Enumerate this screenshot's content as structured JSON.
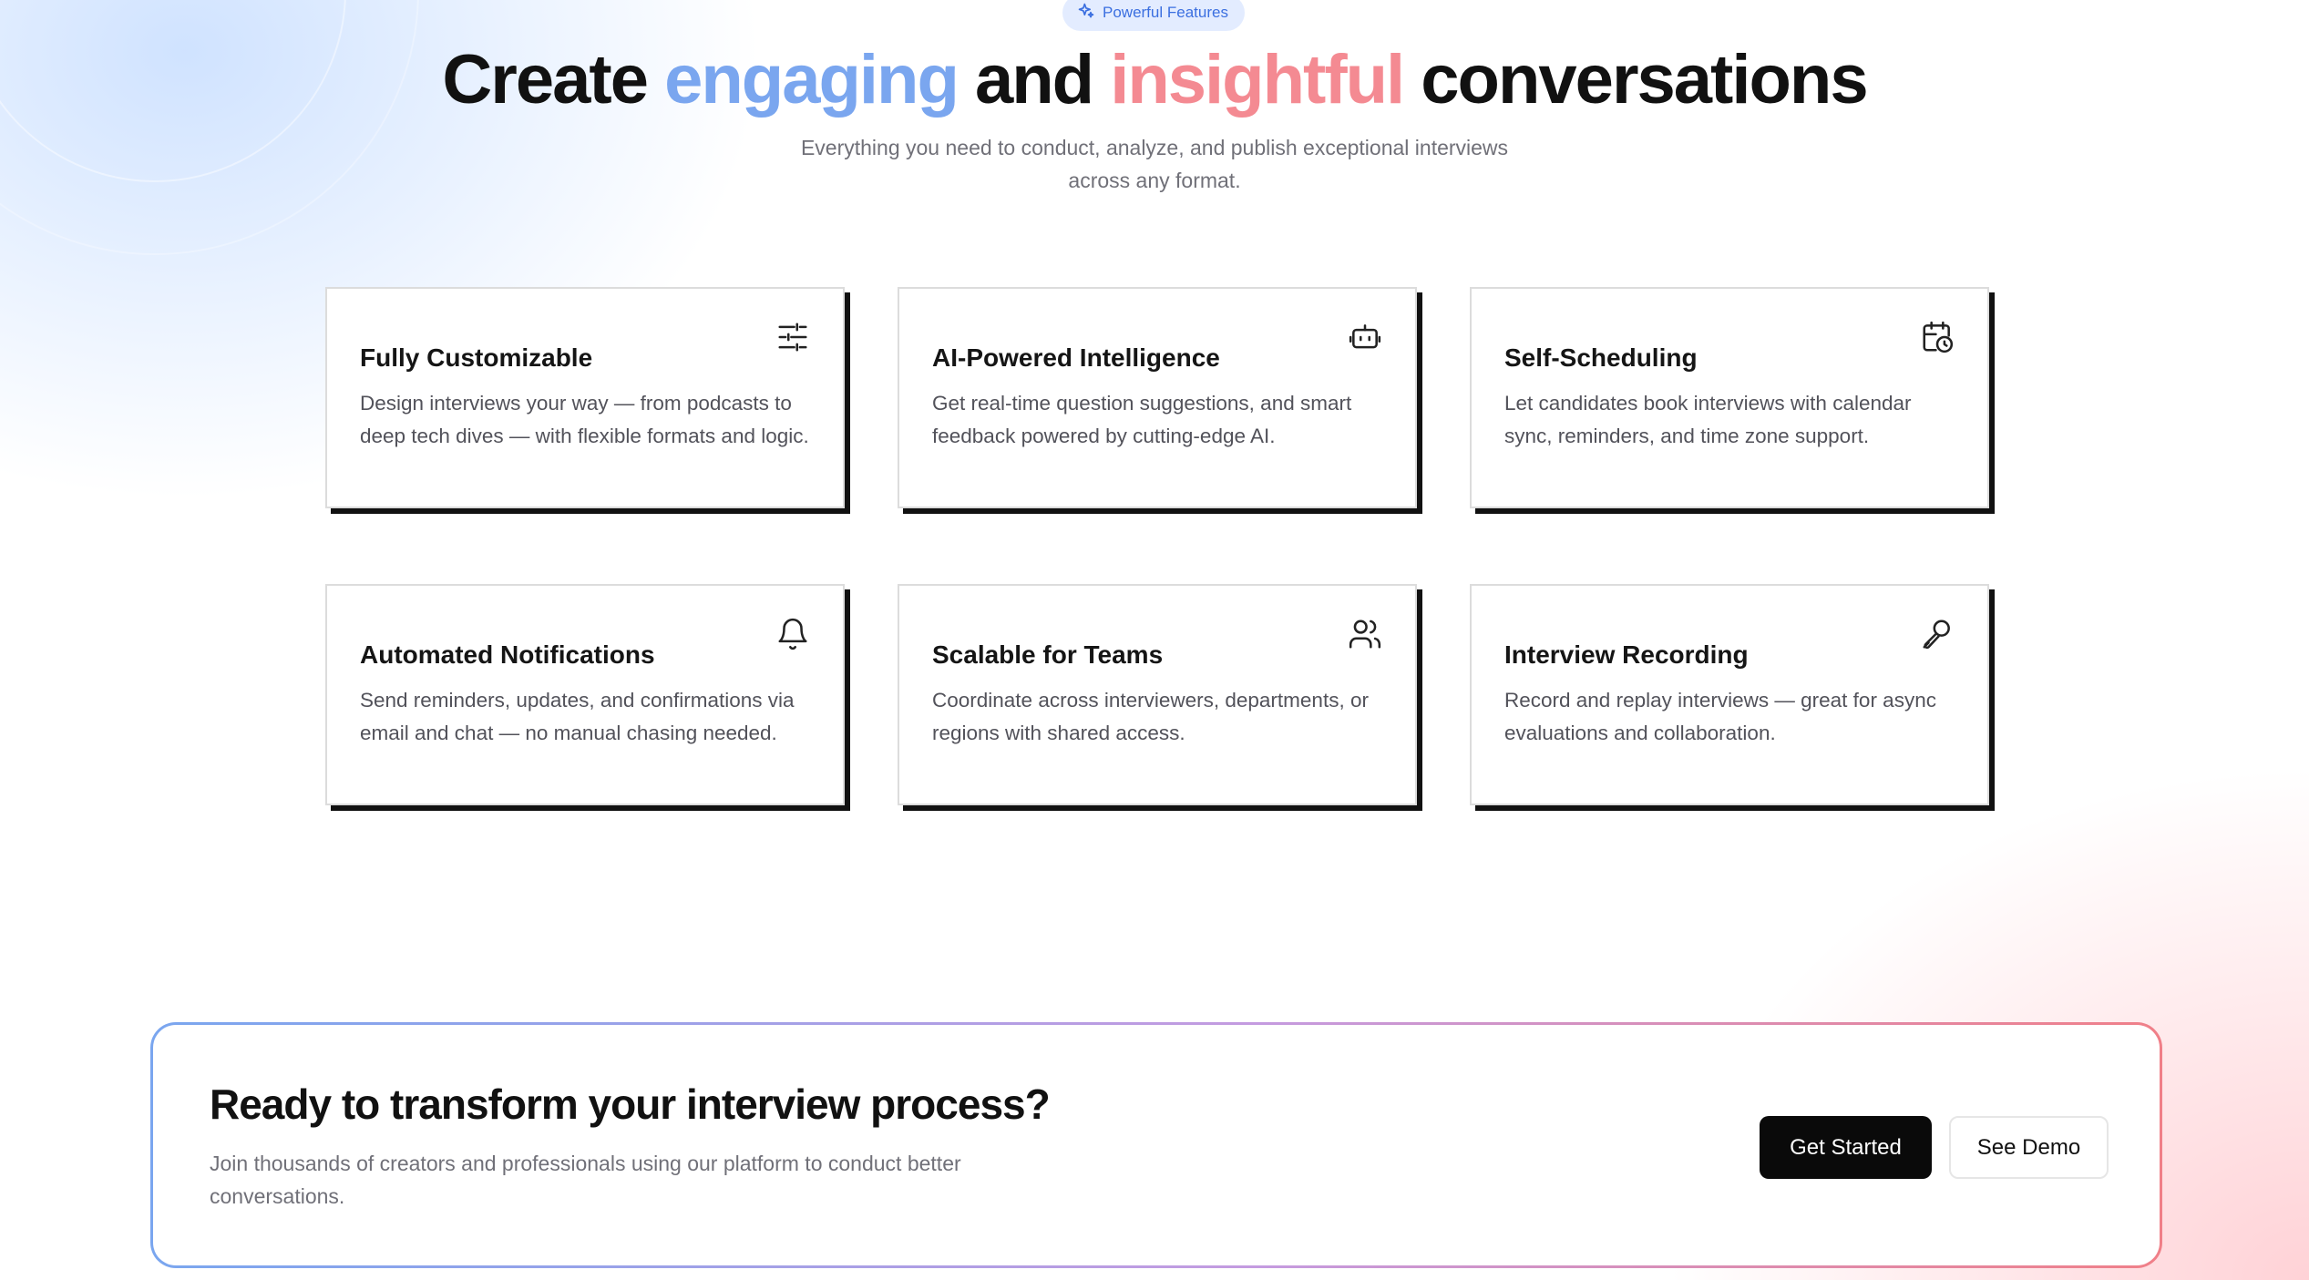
{
  "badge": {
    "icon": "sparkle-icon",
    "label": "Powerful Features"
  },
  "hero": {
    "title_part1": "Create ",
    "title_highlight1": "engaging",
    "title_part2": " and ",
    "title_highlight2": "insightful",
    "title_part3": " conversations",
    "subtitle_line1": "Everything you need to conduct, analyze, and publish exceptional interviews",
    "subtitle_line2": "across any format.",
    "highlight1_color": "#7aa6ef",
    "highlight2_color": "#f48a92"
  },
  "features": [
    {
      "title": "Fully Customizable",
      "icon": "sliders-icon",
      "description": "Design interviews your way — from podcasts to deep tech dives — with flexible formats and logic."
    },
    {
      "title": "AI-Powered Intelligence",
      "icon": "bot-icon",
      "description": "Get real-time question suggestions, and smart feedback powered by cutting-edge AI."
    },
    {
      "title": "Self-Scheduling",
      "icon": "calendar-clock-icon",
      "description": "Let candidates book interviews with calendar sync, reminders, and time zone support."
    },
    {
      "title": "Automated Notifications",
      "icon": "bell-icon",
      "description": "Send reminders, updates, and confirmations via email and chat — no manual chasing needed."
    },
    {
      "title": "Scalable for Teams",
      "icon": "users-icon",
      "description": "Coordinate across interviewers, departments, or regions with shared access."
    },
    {
      "title": "Interview Recording",
      "icon": "microphone-icon",
      "description": "Record and replay interviews — great for async evaluations and collaboration."
    }
  ],
  "cta": {
    "title": "Ready to transform your interview process?",
    "subtitle": "Join thousands of creators and professionals using our platform to conduct better conversations.",
    "primary_label": "Get Started",
    "secondary_label": "See Demo",
    "gradient_start": "#7aa6ef",
    "gradient_end": "#f07f88"
  }
}
